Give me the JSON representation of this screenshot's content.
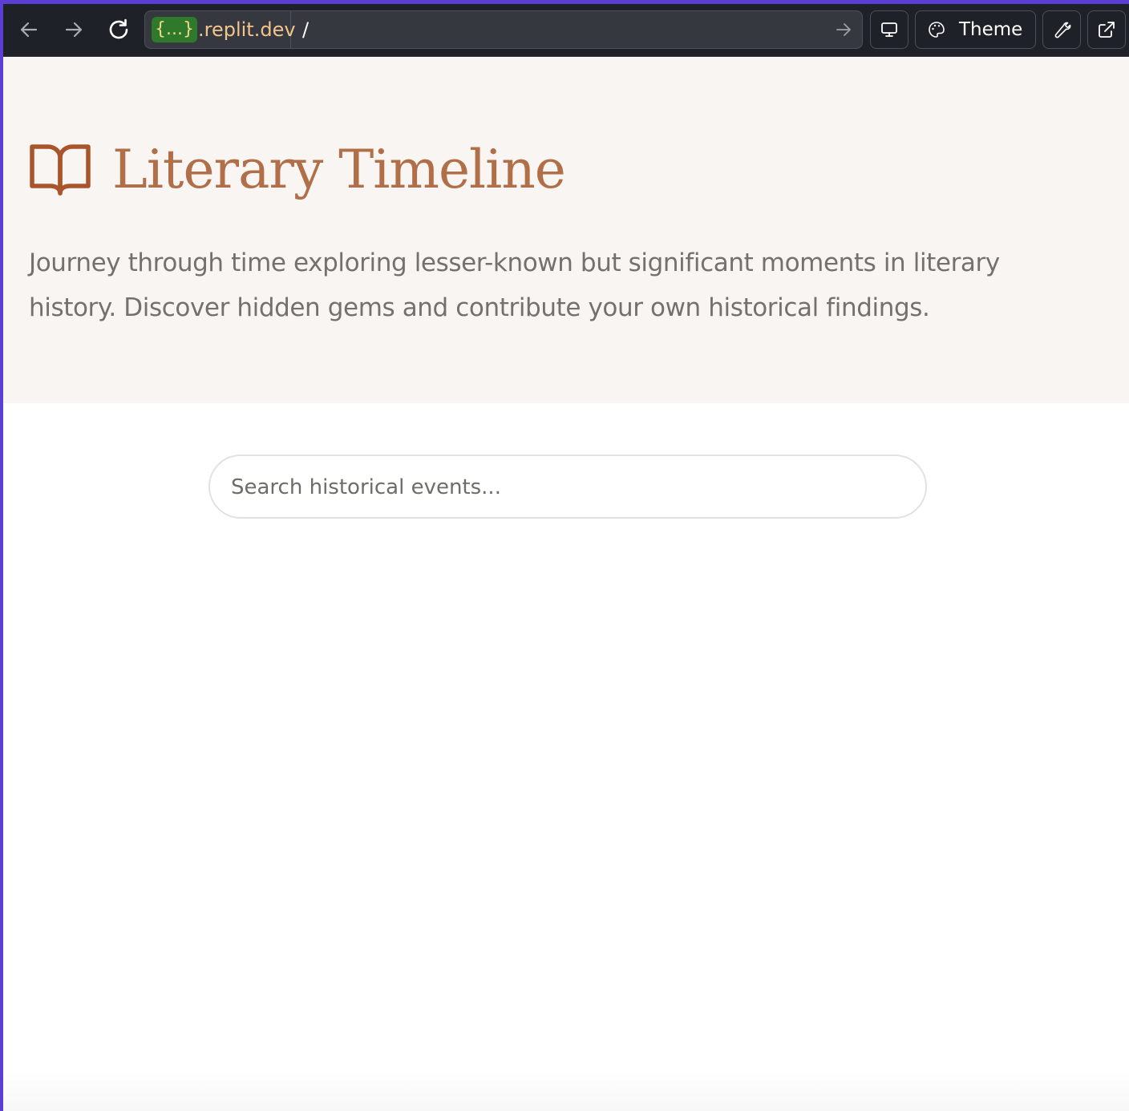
{
  "browser": {
    "domain_badge": "{...}",
    "domain_suffix": ".replit.dev",
    "path": "/",
    "theme_label": "Theme",
    "icons": {
      "back": "arrow-left-icon",
      "forward": "arrow-right-icon",
      "reload": "reload-icon",
      "go": "arrow-right-icon",
      "devices": "monitor-icon",
      "theme": "palette-icon",
      "tools": "wrench-icon",
      "new_tab": "external-link-icon"
    },
    "colors": {
      "frame_accent": "#5b3fd4",
      "toolbar_bg": "#1f2128",
      "badge_bg": "#2f7a2a",
      "domain_text": "#f3c48c"
    }
  },
  "page": {
    "title": "Literary Timeline",
    "title_icon": "book-open-icon",
    "intro": "Journey through time exploring lesser-known but significant moments in literary history. Discover hidden gems and contribute your own historical findings.",
    "search": {
      "placeholder": "Search historical events...",
      "value": ""
    },
    "colors": {
      "accent": "#b06f48",
      "hero_bg": "#f9f5f2",
      "body_text": "#76706c"
    }
  }
}
